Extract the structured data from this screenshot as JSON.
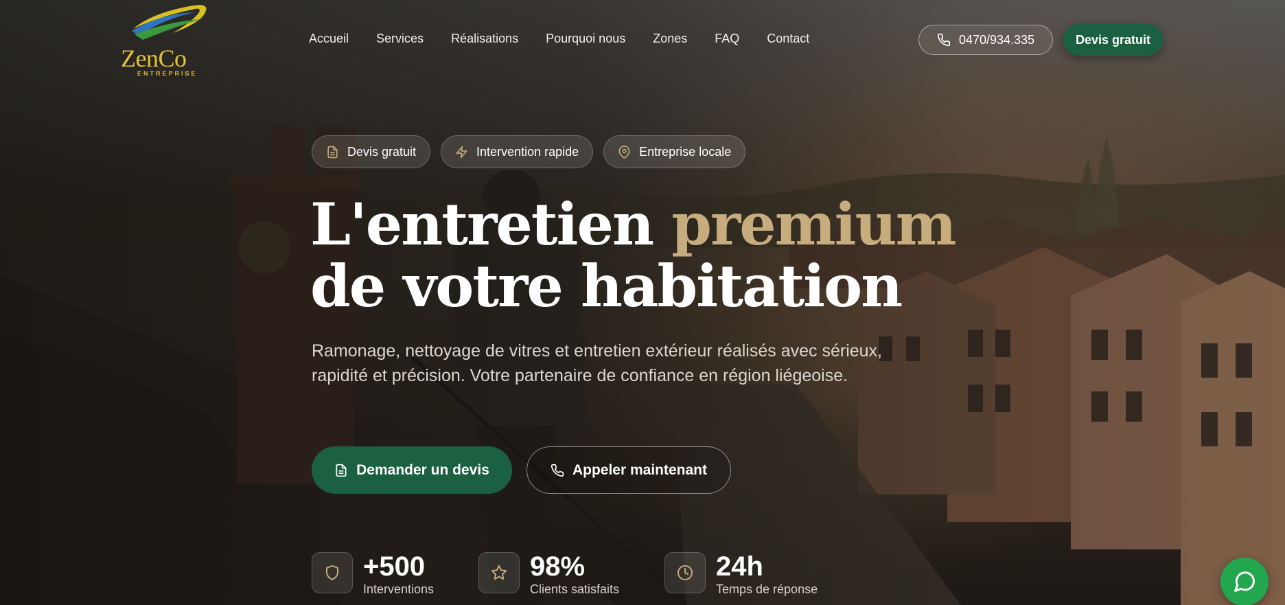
{
  "brand": {
    "name": "ZenCo",
    "subtitle": "ENTREPRISE"
  },
  "nav": {
    "items": [
      "Accueil",
      "Services",
      "Réalisations",
      "Pourquoi nous",
      "Zones",
      "FAQ",
      "Contact"
    ]
  },
  "header": {
    "phone": "0470/934.335",
    "cta": "Devis gratuit"
  },
  "badges": [
    {
      "label": "Devis gratuit",
      "icon": "document-icon"
    },
    {
      "label": "Intervention rapide",
      "icon": "lightning-icon"
    },
    {
      "label": "Entreprise locale",
      "icon": "map-pin-icon"
    }
  ],
  "hero": {
    "title_part1": "L'entretien ",
    "title_accent": "premium",
    "title_line2": "de votre habitation",
    "subtitle": "Ramonage, nettoyage de vitres et entretien extérieur réalisés avec sérieux, rapidité et précision. Votre partenaire de confiance en région liégeoise.",
    "cta_primary": "Demander un devis",
    "cta_secondary": "Appeler maintenant"
  },
  "stats": [
    {
      "value": "+500",
      "label": "Interventions",
      "icon": "shield-icon"
    },
    {
      "value": "98%",
      "label": "Clients satisfaits",
      "icon": "star-icon"
    },
    {
      "value": "24h",
      "label": "Temps de réponse",
      "icon": "clock-icon"
    }
  ],
  "colors": {
    "primary_green": "#1b6141",
    "accent_gold": "#c7ac7e",
    "logo_yellow": "#e3c23a",
    "chat_green": "#22a74f"
  }
}
